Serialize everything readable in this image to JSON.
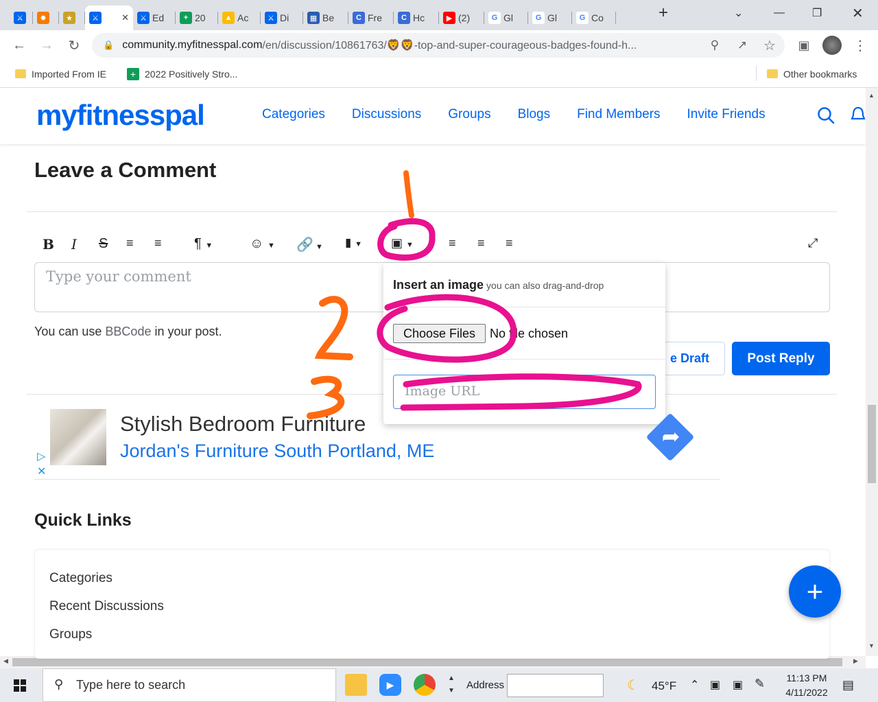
{
  "browser": {
    "tabs": [
      {
        "label": "",
        "favicon": "fitness-icon",
        "color": "#0066ee"
      },
      {
        "label": "",
        "favicon": "fire-icon",
        "color": "#f57c00"
      },
      {
        "label": "",
        "favicon": "trophy-icon",
        "color": "#c9a227"
      },
      {
        "label": "",
        "favicon": "fitness-icon",
        "color": "#0066ee",
        "active": true
      },
      {
        "label": "Ed",
        "favicon": "fitness-icon",
        "color": "#0066ee"
      },
      {
        "label": "20",
        "favicon": "sheets-icon",
        "color": "#0f9d58"
      },
      {
        "label": "Ac",
        "favicon": "drive-icon",
        "color": "#fbbc05"
      },
      {
        "label": "Di",
        "favicon": "fitness-icon",
        "color": "#0066ee"
      },
      {
        "label": "Be",
        "favicon": "tile-icon",
        "color": "#2a5db0"
      },
      {
        "label": "Fre",
        "favicon": "c-logo-icon",
        "color": "#3b6bd6"
      },
      {
        "label": "Hc",
        "favicon": "c-logo-icon",
        "color": "#3b6bd6"
      },
      {
        "label": "(2)",
        "favicon": "youtube-icon",
        "color": "#ff0000"
      },
      {
        "label": "Gl",
        "favicon": "google-icon",
        "color": "#4285f4"
      },
      {
        "label": "Gl",
        "favicon": "google-icon",
        "color": "#4285f4"
      },
      {
        "label": "Co",
        "favicon": "google-icon",
        "color": "#4285f4"
      }
    ],
    "url_domain": "community.myfitnesspal.com",
    "url_path": "/en/discussion/10861763/🦁🦁-top-and-super-courageous-badges-found-h...",
    "bookmarks": [
      {
        "label": "Imported From IE"
      },
      {
        "label": "2022 Positively Stro..."
      }
    ],
    "other_bookmarks": "Other bookmarks"
  },
  "site": {
    "logo": "myfitnesspal",
    "nav": [
      "Categories",
      "Discussions",
      "Groups",
      "Blogs",
      "Find Members",
      "Invite Friends"
    ]
  },
  "comment": {
    "heading": "Leave a Comment",
    "placeholder": "Type your comment",
    "bbcode_prefix": "You can use ",
    "bbcode_link": "BBCode",
    "bbcode_suffix": " in your post.",
    "draft_label": "e Draft",
    "post_label": "Post Reply"
  },
  "image_popup": {
    "title": "Insert an image",
    "subtitle": "you can also drag-and-drop",
    "choose_label": "Choose Files",
    "no_file": "No file chosen",
    "url_placeholder": "Image URL"
  },
  "ad": {
    "title": "Stylish Bedroom Furniture",
    "subtitle": "Jordan's Furniture South Portland, ME"
  },
  "quick_links": {
    "heading": "Quick Links",
    "items": [
      "Categories",
      "Recent Discussions",
      "Groups"
    ]
  },
  "taskbar": {
    "search_placeholder": "Type here to search",
    "address_label": "Address",
    "weather": "45°F",
    "time": "11:13 PM",
    "date": "4/11/2022"
  },
  "annotations": {
    "color_pink": "#e8118f",
    "color_orange": "#ff6a10"
  }
}
